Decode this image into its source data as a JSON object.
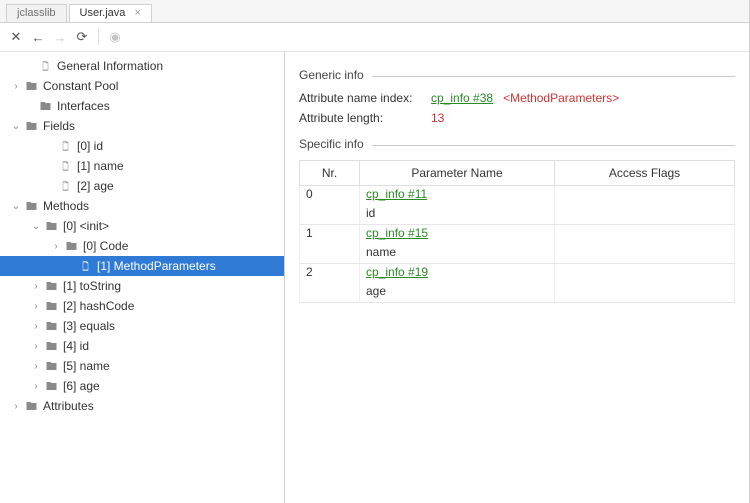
{
  "tabs": {
    "inactive": "jclasslib",
    "active": "User.java",
    "close_glyph": "×"
  },
  "toolbar": {
    "close": "✕",
    "back": "←",
    "forward": "→",
    "refresh": "⟳",
    "browser": "◉"
  },
  "tree": {
    "general": "General Information",
    "constant_pool": "Constant Pool",
    "interfaces": "Interfaces",
    "fields": "Fields",
    "fields_items": {
      "id": "[0] id",
      "name": "[1] name",
      "age": "[2] age"
    },
    "methods": "Methods",
    "m0": "[0] <init>",
    "m0_code": "[0] Code",
    "m0_mp": "[1] MethodParameters",
    "m1": "[1] toString",
    "m2": "[2] hashCode",
    "m3": "[3] equals",
    "m4": "[4] id",
    "m5": "[5] name",
    "m6": "[6] age",
    "attributes": "Attributes"
  },
  "content": {
    "section_generic": "Generic info",
    "attr_name_key": "Attribute name index:",
    "attr_name_link": "cp_info #38",
    "attr_name_red": "<MethodParameters>",
    "attr_len_key": "Attribute length:",
    "attr_len_val": "13",
    "section_specific": "Specific info"
  },
  "table": {
    "headers": {
      "nr": "Nr.",
      "pname": "Parameter Name",
      "flags": "Access Flags"
    },
    "rows": [
      {
        "nr": "0",
        "link": "cp_info #11",
        "name": "id"
      },
      {
        "nr": "1",
        "link": "cp_info #15",
        "name": "name"
      },
      {
        "nr": "2",
        "link": "cp_info #19",
        "name": "age"
      }
    ]
  }
}
